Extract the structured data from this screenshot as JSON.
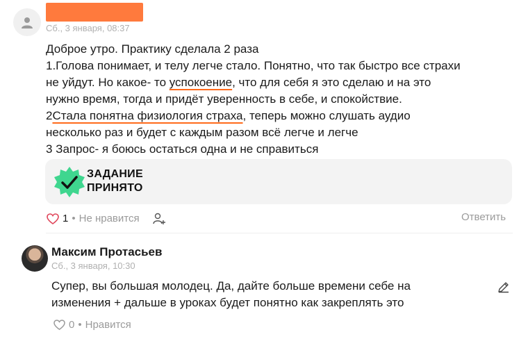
{
  "post": {
    "timestamp": "Сб., 3 января, 08:37",
    "lines": {
      "l1": "Доброе утро. Практику сделала 2 раза",
      "l2": "1.Голова понимает, и телу легче стало. Понятно, что так быстро все страхи",
      "l3a": "не уйдут. Но какое- то ",
      "l3b": "успокоение",
      "l3c": ", что для себя я это сделаю и на это",
      "l4": "нужно время, тогда и придёт уверенность в себе, и спокойствие.",
      "l5a": "2",
      "l5b": "Стала понятна физиология страха",
      "l5c": ", теперь можно слушать аудио",
      "l6": "несколько раз и будет с каждым разом всё легче и легче",
      "l7": "3 Запрос- я боюсь остаться одна и не справиться"
    },
    "badge": {
      "line1": "ЗАДАНИЕ",
      "line2": "ПРИНЯТО",
      "color": "#3fd68f"
    },
    "likes": "1",
    "dislike_label": "Не нравится",
    "reply_label": "Ответить"
  },
  "reply": {
    "author": "Максим Протасьев",
    "timestamp": "Сб., 3 января, 10:30",
    "line1": "Супер, вы большая молодец. Да, дайте больше времени себе на",
    "line2": "изменения + дальше в уроках будет понятно как закреплять это",
    "likes": "0",
    "like_label": "Нравится"
  },
  "colors": {
    "accent": "#ff6a1a",
    "like_heart": "#e0455a",
    "muted": "#9a9a9a"
  },
  "icons": [
    "user-icon",
    "checkmark-badge-icon",
    "heart-icon",
    "add-user-icon",
    "edit-pencil-icon"
  ]
}
